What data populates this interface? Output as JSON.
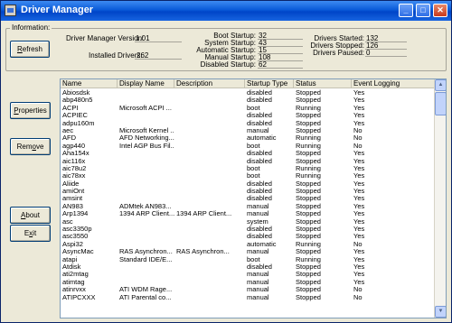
{
  "window": {
    "title": "Driver Manager"
  },
  "info": {
    "group_label": "Information:",
    "version_label": "Driver Manager Version:",
    "version_value": "1.01",
    "installed_label": "Installed Drivers:",
    "installed_value": "262",
    "boot_label": "Boot Startup:",
    "boot_value": "32",
    "system_label": "System Startup:",
    "system_value": "43",
    "automatic_label": "Automatic Startup:",
    "automatic_value": "15",
    "manual_label": "Manual Startup:",
    "manual_value": "108",
    "disabled_label": "Disabled Startup:",
    "disabled_value": "62",
    "started_label": "Drivers Started:",
    "started_value": "132",
    "stopped_label": "Drivers Stopped:",
    "stopped_value": "126",
    "paused_label": "Drivers Paused:",
    "paused_value": "0"
  },
  "buttons": {
    "refresh": {
      "ul": "R",
      "rest": "efresh"
    },
    "properties": {
      "ul": "P",
      "rest": "roperties"
    },
    "remove": {
      "pre": "Rem",
      "ul": "o",
      "rest": "ve"
    },
    "about": {
      "ul": "A",
      "rest": "bout"
    },
    "exit": {
      "pre": "E",
      "ul": "x",
      "rest": "it"
    }
  },
  "table": {
    "columns": [
      "Name",
      "Display Name",
      "Description",
      "Startup Type",
      "Status",
      "Event Logging"
    ],
    "rows": [
      [
        "Abiosdsk",
        "",
        "",
        "disabled",
        "Stopped",
        "Yes"
      ],
      [
        "abp480n5",
        "",
        "",
        "disabled",
        "Stopped",
        "Yes"
      ],
      [
        "ACPI",
        "Microsoft ACPI ...",
        "",
        "boot",
        "Running",
        "Yes"
      ],
      [
        "ACPIEC",
        "",
        "",
        "disabled",
        "Stopped",
        "Yes"
      ],
      [
        "adpu160m",
        "",
        "",
        "disabled",
        "Stopped",
        "Yes"
      ],
      [
        "aec",
        "Microsoft Kernel ...",
        "",
        "manual",
        "Stopped",
        "No"
      ],
      [
        "AFD",
        "AFD Networking...",
        "",
        "automatic",
        "Running",
        "No"
      ],
      [
        "agp440",
        "Intel AGP Bus Fil...",
        "",
        "boot",
        "Running",
        "No"
      ],
      [
        "Aha154x",
        "",
        "",
        "disabled",
        "Stopped",
        "Yes"
      ],
      [
        "aic116x",
        "",
        "",
        "disabled",
        "Stopped",
        "Yes"
      ],
      [
        "aic78u2",
        "",
        "",
        "boot",
        "Running",
        "Yes"
      ],
      [
        "aic78xx",
        "",
        "",
        "boot",
        "Running",
        "Yes"
      ],
      [
        "Aliide",
        "",
        "",
        "disabled",
        "Stopped",
        "Yes"
      ],
      [
        "amiOnt",
        "",
        "",
        "disabled",
        "Stopped",
        "Yes"
      ],
      [
        "amsint",
        "",
        "",
        "disabled",
        "Stopped",
        "Yes"
      ],
      [
        "AN983",
        "ADMtek AN983...",
        "",
        "manual",
        "Stopped",
        "Yes"
      ],
      [
        "Arp1394",
        "1394 ARP Client...",
        "1394 ARP Client...",
        "manual",
        "Stopped",
        "Yes"
      ],
      [
        "asc",
        "",
        "",
        "system",
        "Stopped",
        "Yes"
      ],
      [
        "asc3350p",
        "",
        "",
        "disabled",
        "Stopped",
        "Yes"
      ],
      [
        "asc3550",
        "",
        "",
        "disabled",
        "Stopped",
        "Yes"
      ],
      [
        "Aspi32",
        "",
        "",
        "automatic",
        "Running",
        "No"
      ],
      [
        "AsyncMac",
        "RAS Asynchron...",
        "RAS Asynchron...",
        "manual",
        "Stopped",
        "Yes"
      ],
      [
        "atapi",
        "Standard IDE/E...",
        "",
        "boot",
        "Running",
        "Yes"
      ],
      [
        "Atdisk",
        "",
        "",
        "disabled",
        "Stopped",
        "Yes"
      ],
      [
        "ati2mtag",
        "",
        "",
        "manual",
        "Stopped",
        "Yes"
      ],
      [
        "atimtag",
        "",
        "",
        "manual",
        "Stopped",
        "Yes"
      ],
      [
        "atinrvxx",
        "ATI WDM Rage...",
        "",
        "manual",
        "Stopped",
        "No"
      ],
      [
        "ATIPCXXX",
        "ATI Parental co...",
        "",
        "manual",
        "Stopped",
        "No"
      ]
    ]
  }
}
